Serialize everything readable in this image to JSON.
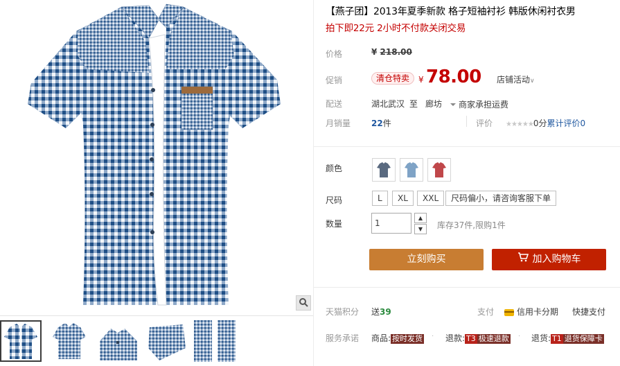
{
  "product": {
    "title": "【燕子团】2013年夏季新款 格子短袖衬衫 韩版休闲衬衣男",
    "subtitle": "拍下即22元 2小时不付款关闭交易"
  },
  "price_row": {
    "label": "价格",
    "currency": "¥",
    "value": "218.00"
  },
  "promo_row": {
    "label": "促销",
    "tag": "清仓特卖",
    "currency": "¥",
    "price": "78.00",
    "store_activity": "店铺活动",
    "chevron": "∨"
  },
  "delivery": {
    "label": "配送",
    "from": "湖北武汉",
    "to_word": "至",
    "dest": "廊坊",
    "shipping": "商家承担运费"
  },
  "sales": {
    "label": "月销量",
    "count": "22",
    "unit": "件",
    "rating_label": "评价",
    "stars": "★★★★★",
    "score": "0分",
    "cumulative": "累计评价",
    "reviews": "0"
  },
  "options": {
    "color_label": "颜色",
    "colors": [
      {
        "name": "灰蓝格",
        "color": "#5a6a80"
      },
      {
        "name": "浅蓝格",
        "color": "#7fa3c6"
      },
      {
        "name": "红格",
        "color": "#c0474a"
      }
    ],
    "size_label": "尺码",
    "sizes": [
      "L",
      "XL",
      "XXL"
    ],
    "size_note": "尺码偏小，请咨询客服下单",
    "qty_label": "数量",
    "qty_value": "1",
    "stock_note": "库存37件,限购1件"
  },
  "actions": {
    "buy_now": "立刻购买",
    "add_to_cart": "加入购物车"
  },
  "points": {
    "label": "天猫积分",
    "give": "送",
    "amount": "39",
    "pay_label": "支付",
    "credit_card": "信用卡分期",
    "quick_pay": "快捷支付"
  },
  "service": {
    "label": "服务承诺",
    "goods": "商品:",
    "goods_badge": "按时发货",
    "refund": "退款:",
    "refund_badge_code": "T3",
    "refund_badge": "极速退款",
    "return": "退货:",
    "return_badge_code": "T1",
    "return_badge": "退货保障卡"
  },
  "colors": {
    "accent_red": "#c40000",
    "buy_button": "#c87d32",
    "cart_button": "#c12100",
    "points_green": "#2b8a3e"
  },
  "icons": [
    "zoom-icon",
    "cart-icon",
    "credit-card-icon",
    "chevron-down-icon",
    "spinner-up-icon",
    "spinner-down-icon"
  ]
}
